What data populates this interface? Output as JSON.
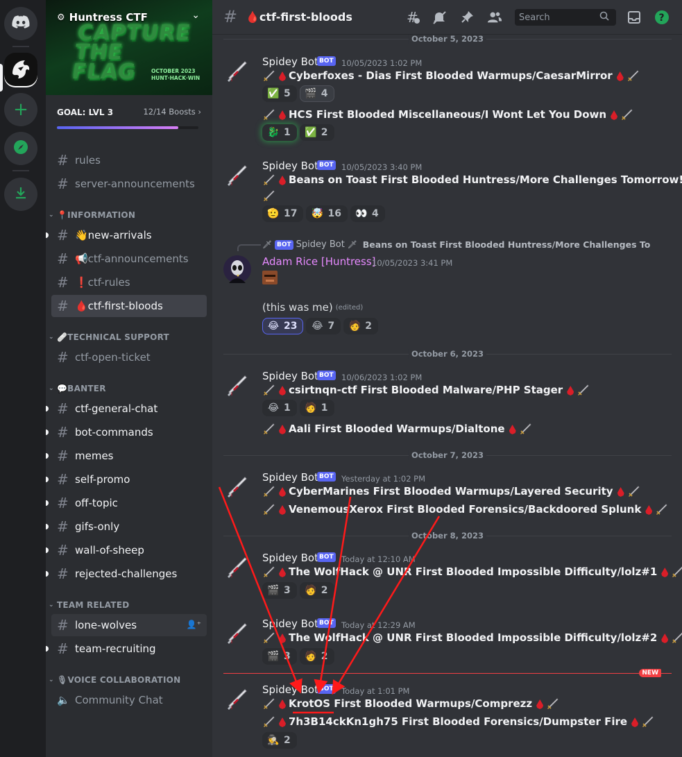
{
  "colors": {
    "accent": "#5865f2",
    "blood": "#da1e28",
    "new": "#f23f43",
    "annotation": "#ff1a1a",
    "online": "#23a55a"
  },
  "rail": {
    "home_icon": "discord-logo-icon",
    "server_icon": "huntress-logo-icon",
    "add_icon": "plus-icon",
    "explore_icon": "compass-icon",
    "download_icon": "download-icon"
  },
  "server": {
    "name": "Huntress CTF",
    "banner_title": "CAPTURE THE FLAG",
    "banner_sub": "OCTOBER 2023 HUNT·HACK·WIN",
    "goal_label": "GOAL: LVL 3",
    "boosts": "12/14 Boosts",
    "goal_progress": 0.857
  },
  "channels": [
    {
      "name": "rules",
      "icon": "#"
    },
    {
      "name": "server-announcements",
      "icon": "#"
    }
  ],
  "categories": {
    "information": "📍INFORMATION",
    "technical": "🩹TECHNICAL SUPPORT",
    "banter": "💬BANTER",
    "team": "TEAM RELATED",
    "voice": "🎙VOICE COLLABORATION"
  },
  "info_channels": [
    {
      "name": "👋new-arrivals"
    },
    {
      "name": "📢ctf-announcements"
    },
    {
      "name": "❗ctf-rules"
    },
    {
      "name": "🩸ctf-first-bloods"
    }
  ],
  "tech_channels": [
    {
      "name": "ctf-open-ticket"
    }
  ],
  "banter_channels": [
    {
      "name": "ctf-general-chat"
    },
    {
      "name": "bot-commands"
    },
    {
      "name": "memes"
    },
    {
      "name": "self-promo"
    },
    {
      "name": "off-topic"
    },
    {
      "name": "gifs-only"
    },
    {
      "name": "wall-of-sheep"
    },
    {
      "name": "rejected-challenges"
    }
  ],
  "team_channels": [
    {
      "name": "lone-wolves"
    },
    {
      "name": "team-recruiting"
    }
  ],
  "voice_channels": [
    {
      "name": "Community Chat"
    }
  ],
  "header": {
    "channel": "🩸ctf-first-bloods",
    "search_placeholder": "Search",
    "icons": [
      "threads-icon",
      "mute-icon",
      "pin-icon",
      "members-icon",
      "inbox-icon",
      "help-icon"
    ]
  },
  "dates": [
    "October 5, 2023",
    "October 6, 2023",
    "October 7, 2023",
    "October 8, 2023"
  ],
  "bot_name": "Spidey Bot",
  "bot_tag": "BOT",
  "messages": [
    {
      "ts": "10/05/2023 1:02 PM",
      "l1": "Cyberfoxes - Dias First Blooded Warmups/CaesarMirror",
      "r1": [
        {
          "icon": "✅",
          "n": "5"
        },
        {
          "icon": "🎬",
          "n": "4"
        }
      ],
      "l2": "HCS First Blooded Miscellaneous/I Wont Let You Down",
      "r2": [
        {
          "icon": "🐉",
          "n": "1"
        },
        {
          "icon": "✅",
          "n": "2"
        }
      ]
    },
    {
      "ts": "10/05/2023 3:40 PM",
      "l1": "Beans on Toast First Blooded Huntress/More Challenges Tomorrow!",
      "r1": [
        {
          "icon": "🫡",
          "n": "17"
        },
        {
          "icon": "🤯",
          "n": "16"
        },
        {
          "icon": "👀",
          "n": "4"
        }
      ]
    },
    {
      "reply_author": "Spidey Bot",
      "reply_text": "Beans on Toast First Blooded Huntress/More Challenges Tomorrow!",
      "user": "Adam Rice [Huntress]",
      "ts": "10/05/2023 3:41 PM",
      "text": "(this was me)",
      "edited": "(edited)",
      "r1": [
        {
          "icon": "😂",
          "n": "23"
        },
        {
          "icon": "😂",
          "n": "7"
        },
        {
          "icon": "🧑",
          "n": "2"
        }
      ]
    },
    {
      "ts": "10/06/2023 1:02 PM",
      "l1": "csirtnqn-ctf First Blooded Malware/PHP Stager",
      "r1": [
        {
          "icon": "😂",
          "n": "1"
        },
        {
          "icon": "🧑",
          "n": "1"
        }
      ],
      "l2": "Aali First Blooded Warmups/Dialtone"
    },
    {
      "ts": "Yesterday at 1:02 PM",
      "l1": "CyberMarines First Blooded Warmups/Layered Security",
      "l2": "VenemousXerox First Blooded Forensics/Backdoored Splunk"
    },
    {
      "ts": "Today at 12:10 AM",
      "l1": "The WolfHack @ UNR First Blooded Impossible Difficulty/lolz#1",
      "r1": [
        {
          "icon": "🎬",
          "n": "3"
        },
        {
          "icon": "🧑",
          "n": "2"
        }
      ]
    },
    {
      "ts": "Today at 12:29 AM",
      "l1": "The WolfHack @ UNR First Blooded Impossible Difficulty/lolz#2",
      "r1": [
        {
          "icon": "🎬",
          "n": "3"
        },
        {
          "icon": "🧑",
          "n": "2"
        }
      ]
    },
    {
      "ts": "Today at 1:01 PM",
      "l1": "KrotOS First Blooded Warmups/Comprezz",
      "l2": "7h3B14ckKn1gh75 First Blooded Forensics/Dumpster Fire",
      "r2": [
        {
          "icon": "🕵",
          "n": "2"
        }
      ]
    }
  ],
  "new_label": "NEW"
}
